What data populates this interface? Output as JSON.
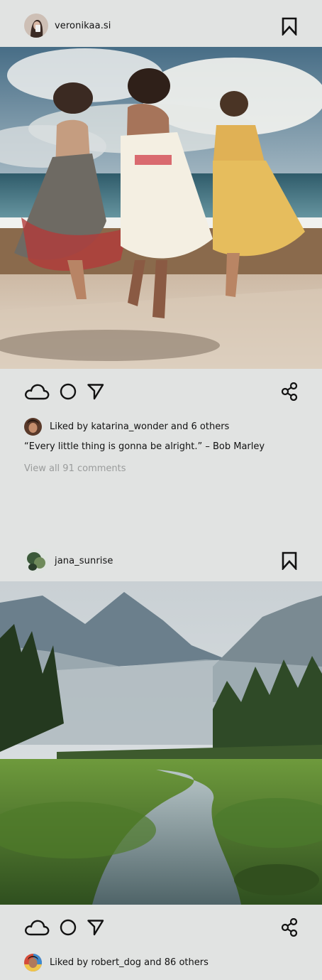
{
  "posts": [
    {
      "username": "veronikaa.si",
      "likes_text": "Liked by katarina_wonder and 6 others",
      "caption": "“Every little thing is gonna be alright.” – Bob Marley",
      "comments_link": "View all 91 comments"
    },
    {
      "username": "jana_sunrise",
      "likes_text": "Liked by robert_dog and 86 others"
    }
  ],
  "icons": [
    "bookmark-icon",
    "cloud-icon",
    "circle-icon",
    "send-icon",
    "share-icon"
  ],
  "colors": {
    "background": "#e1e3e2",
    "text": "#121212",
    "muted": "#9a9c9c"
  }
}
